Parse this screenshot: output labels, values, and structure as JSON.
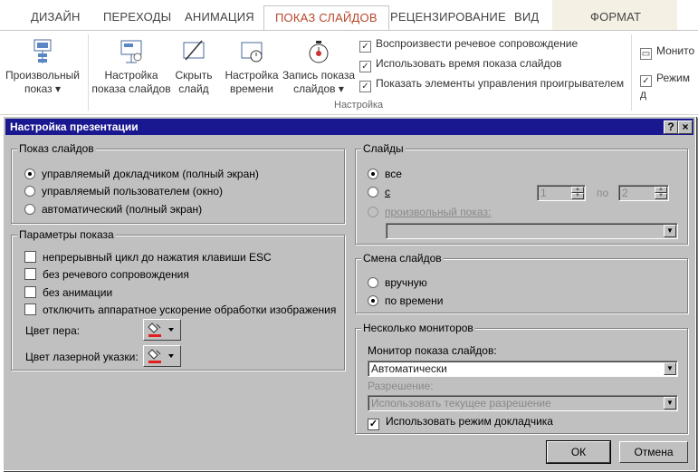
{
  "ribbon": {
    "tabs": [
      "ДИЗАЙН",
      "ПЕРЕХОДЫ",
      "АНИМАЦИЯ",
      "ПОКАЗ СЛАЙДОВ",
      "РЕЦЕНЗИРОВАНИЕ",
      "ВИД",
      "ФОРМАТ"
    ],
    "custom_show": {
      "line1": "Произвольный",
      "line2": "показ ▾"
    },
    "setup_show": {
      "line1": "Настройка",
      "line2": "показа слайдов"
    },
    "hide_slide": {
      "line1": "Скрыть",
      "line2": "слайд"
    },
    "rehearse": {
      "line1": "Настройка",
      "line2": "времени"
    },
    "record": {
      "line1": "Запись показа",
      "line2": "слайдов ▾"
    },
    "checks": [
      "Воспроизвести речевое сопровождение",
      "Использовать время показа слайдов",
      "Показать элементы управления проигрывателем"
    ],
    "group_label": "Настройка",
    "right_items": [
      "Монито",
      "Режим д"
    ]
  },
  "dialog": {
    "title": "Настройка презентации",
    "help": "?",
    "close": "×",
    "show_type": {
      "legend": "Показ слайдов",
      "options": [
        "управляемый докладчиком (полный экран)",
        "управляемый пользователем (окно)",
        "автоматический (полный экран)"
      ]
    },
    "show_options": {
      "legend": "Параметры показа",
      "checks": [
        "непрерывный цикл до нажатия клавиши ESC",
        "без речевого сопровождения",
        "без анимации",
        "отключить аппаратное ускорение обработки изображения"
      ],
      "pen_color": "Цвет пера:",
      "laser_color": "Цвет лазерной указки:"
    },
    "slides": {
      "legend": "Слайды",
      "all": "все",
      "from": "с",
      "from_value": "1",
      "to": "по",
      "to_value": "2",
      "custom": "произвольный показ:"
    },
    "advance": {
      "legend": "Смена слайдов",
      "manual": "вручную",
      "timings": "по времени"
    },
    "monitors": {
      "legend": "Несколько мониторов",
      "monitor_label": "Монитор показа слайдов:",
      "monitor_value": "Автоматически",
      "resolution_label": "Разрешение:",
      "resolution_value": "Использовать текущее разрешение",
      "presenter_view": "Использовать режим докладчика"
    },
    "ok": "ОК",
    "cancel": "Отмена"
  },
  "colors": {
    "title_bar": "#1a1890",
    "dialog_bg": "#c0c0c0",
    "active_tab": "#b7472a",
    "pen_red": "#e02020"
  }
}
